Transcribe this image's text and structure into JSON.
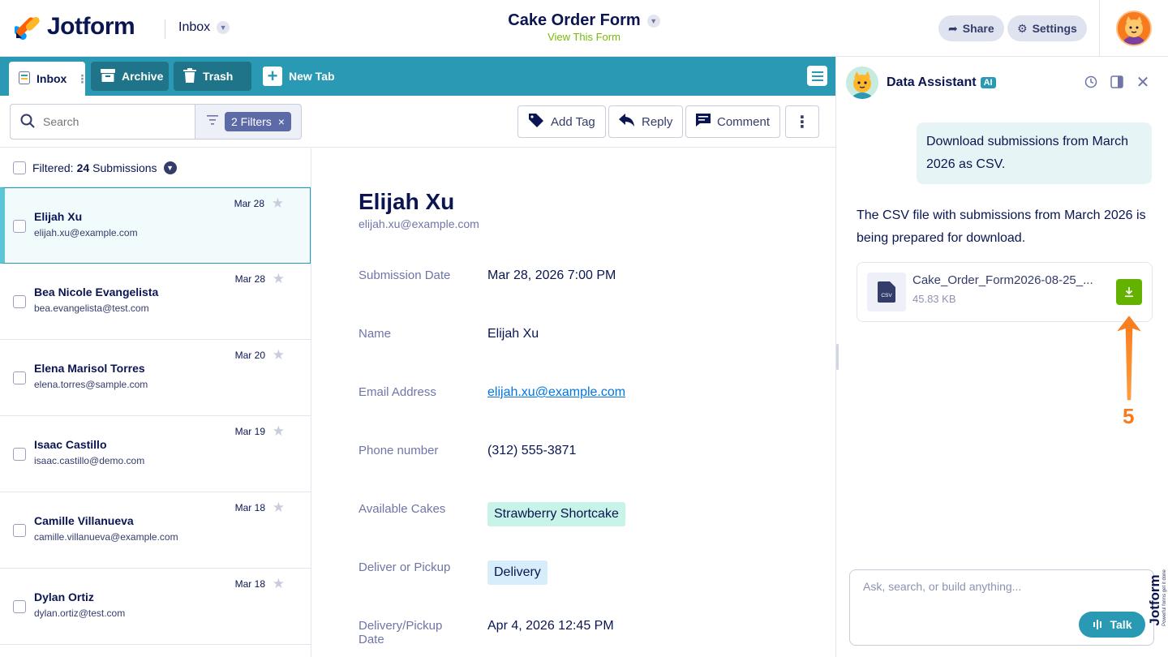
{
  "header": {
    "brand": "Jotform",
    "inbox_label": "Inbox",
    "form_title": "Cake Order Form",
    "view_form": "View This Form",
    "share_label": "Share",
    "settings_label": "Settings"
  },
  "tabs": {
    "inbox": "Inbox",
    "archive": "Archive",
    "trash": "Trash",
    "new_tab": "New Tab"
  },
  "toolbar": {
    "search_placeholder": "Search",
    "filters_label": "2 Filters",
    "add_tag": "Add Tag",
    "reply": "Reply",
    "comment": "Comment"
  },
  "list": {
    "filtered_prefix": "Filtered:",
    "count": "24",
    "suffix": "Submissions",
    "items": [
      {
        "name": "Elijah Xu",
        "email": "elijah.xu@example.com",
        "date": "Mar 28",
        "selected": true
      },
      {
        "name": "Bea Nicole Evangelista",
        "email": "bea.evangelista@test.com",
        "date": "Mar 28"
      },
      {
        "name": "Elena Marisol Torres",
        "email": "elena.torres@sample.com",
        "date": "Mar 20"
      },
      {
        "name": "Isaac Castillo",
        "email": "isaac.castillo@demo.com",
        "date": "Mar 19"
      },
      {
        "name": "Camille Villanueva",
        "email": "camille.villanueva@example.com",
        "date": "Mar 18"
      },
      {
        "name": "Dylan Ortiz",
        "email": "dylan.ortiz@test.com",
        "date": "Mar 18"
      }
    ]
  },
  "detail": {
    "name": "Elijah Xu",
    "email": "elijah.xu@example.com",
    "fields": [
      {
        "label": "Submission Date",
        "value": "Mar 28, 2026 7:00 PM"
      },
      {
        "label": "Name",
        "value": "Elijah Xu"
      },
      {
        "label": "Email Address",
        "value": "elijah.xu@example.com"
      },
      {
        "label": "Phone number",
        "value": "(312) 555-3871"
      },
      {
        "label": "Available Cakes",
        "value": "Strawberry Shortcake"
      },
      {
        "label": "Deliver or Pickup",
        "value": "Delivery"
      },
      {
        "label": "Delivery/Pickup Date",
        "value": "Apr 4, 2026 12:45 PM"
      }
    ]
  },
  "assistant": {
    "title": "Data Assistant",
    "badge": "AI",
    "user_message": "Download submissions from March 2026 as CSV.",
    "ai_message": "The CSV file with submissions from March 2026 is being prepared for download.",
    "file_name": "Cake_Order_Form2026-08-25_...",
    "file_size": "45.83 KB",
    "file_type": "CSV",
    "step_number": "5",
    "chat_placeholder": "Ask, search, or build anything...",
    "talk_label": "Talk",
    "side_brand": "Jotform",
    "side_tagline": "Powerful forms get it done"
  },
  "colors": {
    "teal": "#2a99b3",
    "navy": "#0a1551",
    "green": "#64b200",
    "orange": "#f77b1e"
  }
}
